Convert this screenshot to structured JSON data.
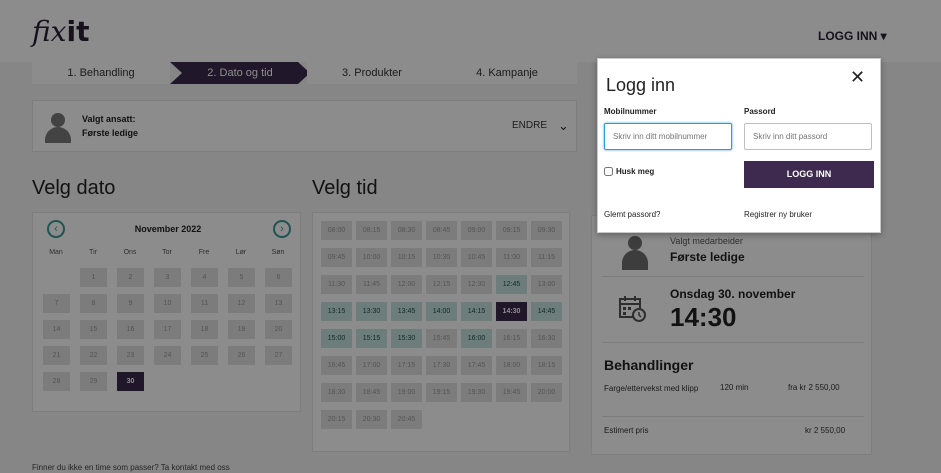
{
  "header": {
    "logo_part1": "fix",
    "logo_part2": "it",
    "login_link": "LOGG INN ▾"
  },
  "steps": [
    {
      "label": "1. Behandling"
    },
    {
      "label": "2. Dato og tid",
      "active": true
    },
    {
      "label": "3. Produkter"
    },
    {
      "label": "4. Kampanje"
    }
  ],
  "employee": {
    "label": "Valgt ansatt:",
    "name": "Første ledige",
    "change": "ENDRE",
    "change_icon": "chevron-down-icon"
  },
  "date_section": {
    "heading": "Velg dato",
    "month": "November 2022",
    "weekdays": [
      "Man",
      "Tir",
      "Ons",
      "Tor",
      "Fre",
      "Lør",
      "Søn"
    ],
    "selected_day": "30",
    "weeks": [
      [
        "",
        "1",
        "2",
        "3",
        "4",
        "5",
        "6"
      ],
      [
        "7",
        "8",
        "9",
        "10",
        "11",
        "12",
        "13"
      ],
      [
        "14",
        "15",
        "16",
        "17",
        "18",
        "19",
        "20"
      ],
      [
        "21",
        "22",
        "23",
        "24",
        "25",
        "26",
        "27"
      ],
      [
        "28",
        "29",
        "30",
        "",
        "",
        "",
        ""
      ]
    ]
  },
  "time_section": {
    "heading": "Velg tid",
    "slots": [
      [
        "08:00",
        "08:15",
        "08:30",
        "08:45",
        "09:00",
        "09:15",
        "09:30"
      ],
      [
        "09:45",
        "10:00",
        "10:15",
        "10:30",
        "10:45",
        "11:00",
        "11:15"
      ],
      [
        "11:30",
        "11:45",
        "12:00",
        "12:15",
        "12:30",
        "12:45",
        "13:00"
      ],
      [
        "13:15",
        "13:30",
        "13:45",
        "14:00",
        "14:15",
        "14:30",
        "14:45"
      ],
      [
        "15:00",
        "15:15",
        "15:30",
        "15:45",
        "16:00",
        "16:15",
        "16:30"
      ],
      [
        "16:45",
        "17:00",
        "17:15",
        "17:30",
        "17:45",
        "18:00",
        "18:15"
      ],
      [
        "18:30",
        "18:45",
        "19:00",
        "19:15",
        "19:30",
        "19:45",
        "20:00"
      ],
      [
        "20:15",
        "20:30",
        "20:45"
      ]
    ],
    "available": [
      "12:45",
      "13:15",
      "13:30",
      "13:45",
      "14:00",
      "14:15",
      "14:30",
      "14:45",
      "15:00",
      "15:15",
      "15:30",
      "16:00"
    ],
    "selected": "14:30"
  },
  "footer_note": "Finner du ikke en time som passer? Ta kontakt med oss",
  "summary": {
    "employee_label": "Valgt medarbeider",
    "employee_name": "Første ledige",
    "date": "Onsdag 30. november",
    "time": "14:30",
    "treatments_heading": "Behandlinger",
    "treatment_name": "Farge/ettervekst med klipp",
    "treatment_duration": "120 min",
    "treatment_price": "fra kr  2 550,00",
    "estimate_label": "Estimert pris",
    "estimate_value": "kr  2 550,00"
  },
  "login_modal": {
    "title": "Logg inn",
    "close_icon": "close-icon",
    "phone_label": "Mobilnummer",
    "phone_placeholder": "Skriv inn ditt mobilnummer",
    "password_label": "Passord",
    "password_placeholder": "Skriv inn ditt passord",
    "remember": "Husk meg",
    "submit": "LOGG INN",
    "forgot": "Glemt passord?",
    "register": "Registrer ny bruker"
  },
  "colors": {
    "brand": "#3d2a4e",
    "available_slot": "#c7e3e1",
    "nav_accent": "#3a9a94",
    "input_focus": "#2a9fd8"
  }
}
